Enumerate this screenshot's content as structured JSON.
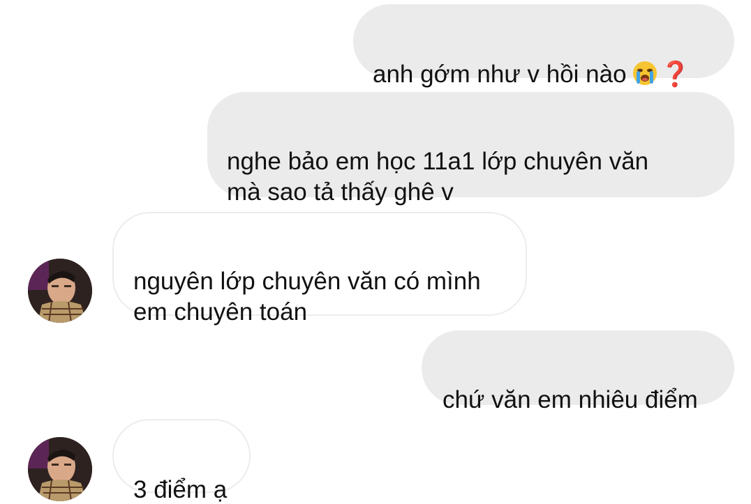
{
  "messages": [
    {
      "direction": "outgoing",
      "text": "anh gớm như v hồi nào",
      "emoji": "loudly-crying-face-emoji",
      "trailing": "❓"
    },
    {
      "direction": "outgoing",
      "text": "nghe bảo em học 11a1 lớp chuyên văn\nmà sao tả thấy ghê v"
    },
    {
      "direction": "incoming",
      "text": "nguyên lớp chuyên văn có mình\nem chuyên toán"
    },
    {
      "direction": "outgoing",
      "text": "chứ văn em nhiêu điểm"
    },
    {
      "direction": "incoming",
      "text": "3 điểm ạ"
    }
  ],
  "colors": {
    "outgoing_bubble": "#ebebeb",
    "incoming_border": "#ececec",
    "question_mark": "#e0242a"
  }
}
